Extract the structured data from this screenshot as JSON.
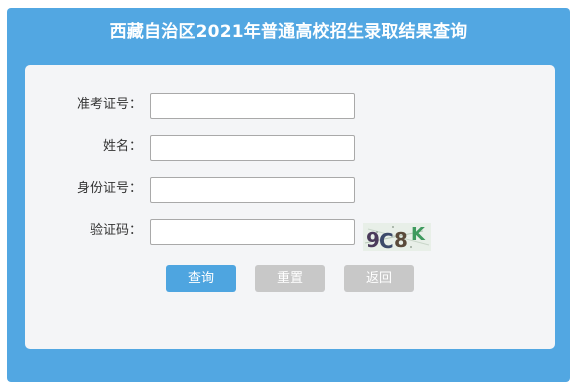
{
  "page": {
    "title": "西藏自治区2021年普通高校招生录取结果查询"
  },
  "form": {
    "exam_number_label": "准考证号：",
    "exam_number_value": "",
    "name_label": "姓名：",
    "name_value": "",
    "id_number_label": "身份证号：",
    "id_number_value": "",
    "captcha_label": "验证码：",
    "captcha_value": "",
    "captcha_image_text": "9C8K"
  },
  "buttons": {
    "query": "查询",
    "reset": "重置",
    "back": "返回"
  },
  "colors": {
    "header_blue": "#52a7e2",
    "primary_button": "#4ea5e0",
    "disabled_button": "#c8c8c8",
    "card_background": "#f4f5f7"
  }
}
